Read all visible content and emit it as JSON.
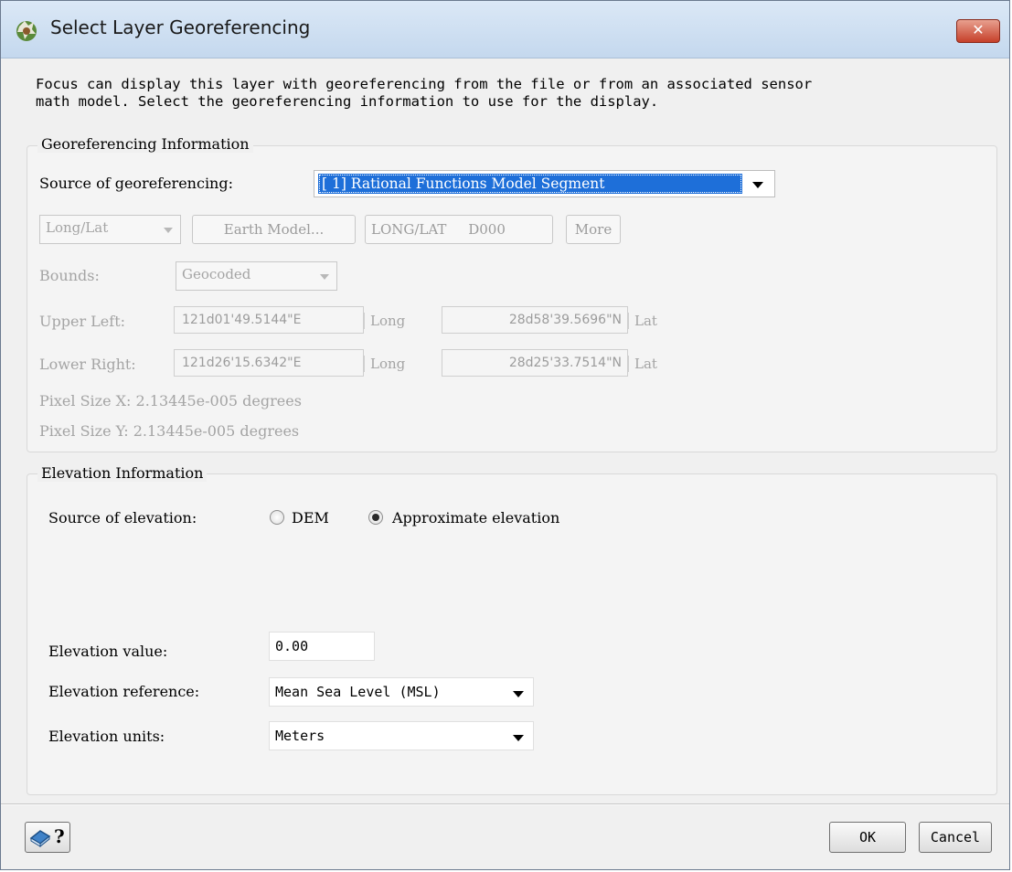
{
  "window": {
    "title": "Select Layer Georeferencing",
    "close_glyph": "✕"
  },
  "description": "Focus can display this layer with georeferencing from the file or from an associated sensor\nmath model. Select the georeferencing information to use for the display.",
  "georef": {
    "group_label": "Georeferencing Information",
    "source_label": "Source of georeferencing:",
    "source_value": "[    1] Rational Functions Model Segment",
    "projection_value": "Long/Lat",
    "earth_model_button": "Earth Model...",
    "projection_code": "LONG/LAT     D000",
    "more_button": "More",
    "bounds_label": "Bounds:",
    "bounds_value": "Geocoded",
    "upper_left_label": "Upper Left:",
    "upper_left_long": "121d01'49.5144\"E",
    "upper_left_lat": "28d58'39.5696\"N",
    "lower_right_label": "Lower Right:",
    "lower_right_long": "121d26'15.6342\"E",
    "lower_right_lat": "28d25'33.7514\"N",
    "long_unit": "Long",
    "lat_unit": "Lat",
    "pixel_x": "Pixel Size X: 2.13445e-005 degrees",
    "pixel_y": "Pixel Size Y: 2.13445e-005 degrees"
  },
  "elevation": {
    "group_label": "Elevation Information",
    "source_label": "Source of elevation:",
    "option_dem": "DEM",
    "option_approx": "Approximate elevation",
    "selected_option": "Approximate elevation",
    "value_label": "Elevation value:",
    "value": "0.00",
    "reference_label": "Elevation reference:",
    "reference_value": "Mean Sea Level (MSL)",
    "units_label": "Elevation units:",
    "units_value": "Meters"
  },
  "footer": {
    "help_glyph": "?",
    "ok_label": "OK",
    "cancel_label": "Cancel"
  },
  "colors": {
    "selection": "#1e6fd9",
    "close_button": "#c6402a"
  },
  "icons": [
    "app-logo-icon",
    "close-icon",
    "dropdown-arrow-icon",
    "radio-icon",
    "help-book-icon"
  ]
}
